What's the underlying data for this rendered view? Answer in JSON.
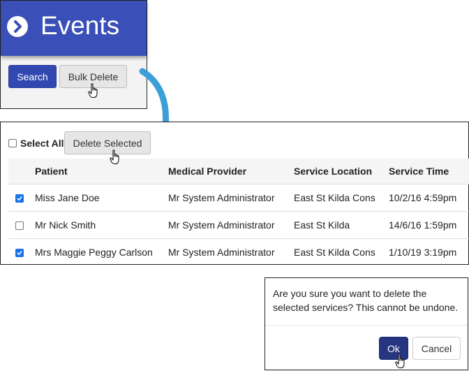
{
  "header": {
    "title": "Events",
    "icon": "chevron-right-circle-icon",
    "accent_color": "#3a4fb7"
  },
  "toolbar": {
    "search_label": "Search",
    "bulk_delete_label": "Bulk Delete"
  },
  "bulk": {
    "select_all_label": "Select All",
    "select_all_checked": false,
    "delete_selected_label": "Delete Selected"
  },
  "table": {
    "columns": [
      "Patient",
      "Medical Provider",
      "Service Location",
      "Service Time"
    ],
    "rows": [
      {
        "checked": true,
        "patient": "Miss Jane Doe",
        "provider": "Mr System Administrator",
        "location": "East St Kilda Cons",
        "time": "10/2/16 4:59pm"
      },
      {
        "checked": false,
        "patient": "Mr Nick Smith",
        "provider": "Mr System Administrator",
        "location": "East St Kilda",
        "time": "14/6/16 1:59pm"
      },
      {
        "checked": true,
        "patient": "Mrs Maggie Peggy Carlson",
        "provider": "Mr System Administrator",
        "location": "East St Kilda Cons",
        "time": "1/10/19 3:19pm"
      }
    ]
  },
  "dialog": {
    "message": "Are you sure you want to delete the selected services? This cannot be undone.",
    "ok_label": "Ok",
    "cancel_label": "Cancel"
  },
  "colors": {
    "primary": "#3148b1",
    "ok_button": "#26357f",
    "arrow": "#3d9fd8",
    "checkbox": "#1a73e8"
  }
}
